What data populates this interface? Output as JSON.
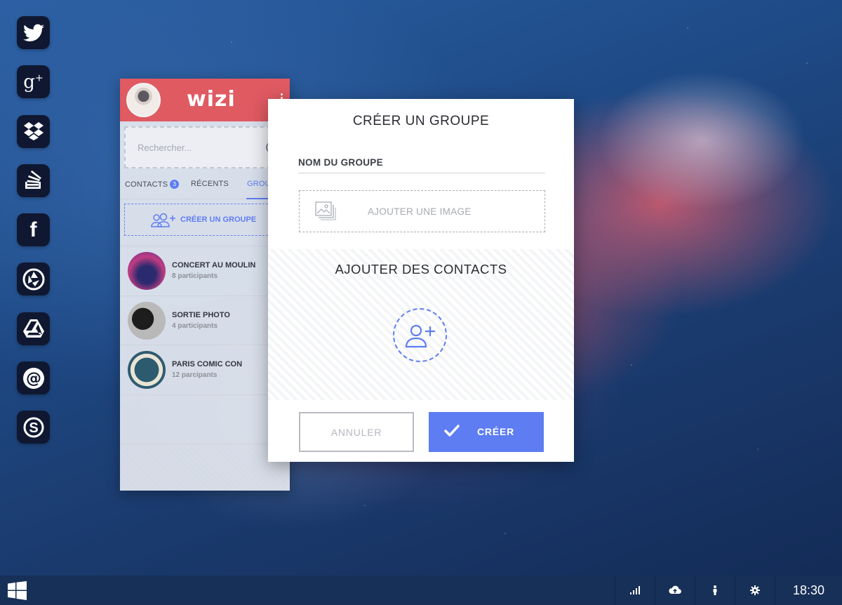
{
  "dock": {
    "items": [
      {
        "name": "twitter",
        "icon": "twitter-icon"
      },
      {
        "name": "google-plus",
        "icon": "google-plus-icon"
      },
      {
        "name": "dropbox",
        "icon": "dropbox-icon"
      },
      {
        "name": "stack-overflow",
        "icon": "stack-icon"
      },
      {
        "name": "facebook",
        "icon": "facebook-icon"
      },
      {
        "name": "picasa",
        "icon": "aperture-icon"
      },
      {
        "name": "google-drive",
        "icon": "drive-icon"
      },
      {
        "name": "mail",
        "icon": "at-icon"
      },
      {
        "name": "skype",
        "icon": "skype-icon"
      }
    ]
  },
  "app": {
    "logo": "wizi",
    "accent": "#e05a62",
    "search_placeholder": "Rechercher...",
    "tabs": [
      {
        "label": "CONTACTS",
        "badge": "3"
      },
      {
        "label": "RÉCENTS"
      },
      {
        "label": "GROU"
      }
    ],
    "create_group_label": "CRÉER UN GROUPE",
    "groups": [
      {
        "name": "CONCERT AU MOULIN",
        "sub": "8 participants"
      },
      {
        "name": "SORTIE PHOTO",
        "sub": "4 participants"
      },
      {
        "name": "PARIS COMIC CON",
        "sub": "12 parcipants"
      }
    ]
  },
  "modal": {
    "title": "CRÉER UN GROUPE",
    "name_label": "NOM DU GROUPE",
    "add_image_label": "AJOUTER UNE IMAGE",
    "contacts_title": "AJOUTER DES CONTACTS",
    "cancel_label": "ANNULER",
    "create_label": "CRÉER",
    "accent": "#5e7df2"
  },
  "taskbar": {
    "clock": "18:30",
    "tray": [
      "signal-icon",
      "cloud-upload-icon",
      "person-icon",
      "settings-icon"
    ]
  }
}
